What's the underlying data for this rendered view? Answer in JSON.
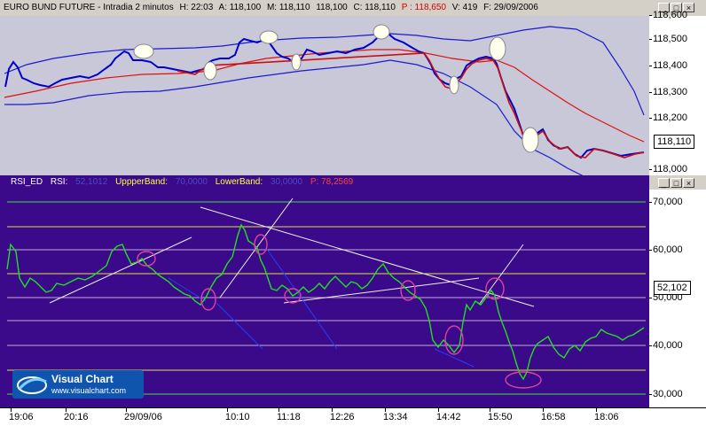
{
  "header": {
    "title": "EURO BUND FUTURE - Intradia 2 minutos",
    "h": "H: 22:03",
    "a": "A: 118,100",
    "m": "M: 118,110",
    "mval": "118,100",
    "c": "C: 118,110",
    "p": "P : 118,650",
    "v": "V: 419",
    "f": "F: 29/09/2006"
  },
  "window_buttons": [
    "_",
    "□",
    "×"
  ],
  "price_axis": [
    "118,600",
    "118,500",
    "118,400",
    "118,300",
    "118,200",
    "118,000"
  ],
  "price_current": "118,110",
  "rsi_header": {
    "name": "RSI_ED",
    "rsi_label": "RSI:",
    "rsi_value": "52,1012",
    "upper_label": "UppperBand:",
    "upper_value": "70,0000",
    "lower_label": "LowerBand:",
    "lower_value": "30,0000",
    "p": "P: 78,2569"
  },
  "rsi_axis": [
    "70,000",
    "60,000",
    "50,000",
    "40,000",
    "30,000"
  ],
  "rsi_current": "52,102",
  "x_axis": [
    "19:06",
    "20:16",
    "29/09/06",
    "10:10",
    "11:18",
    "12:26",
    "13:34",
    "14:42",
    "15:50",
    "16:58",
    "18:06"
  ],
  "logo": {
    "brand": "Visual Chart",
    "url": "www.visualchart.com"
  },
  "colors": {
    "price_bg": "#c8c8d8",
    "rsi_bg": "#3a0a8a",
    "price_line": "#0000cc",
    "ma_line": "#e01010",
    "band_line": "#1a1ad0",
    "rsi_line": "#20e020"
  }
}
